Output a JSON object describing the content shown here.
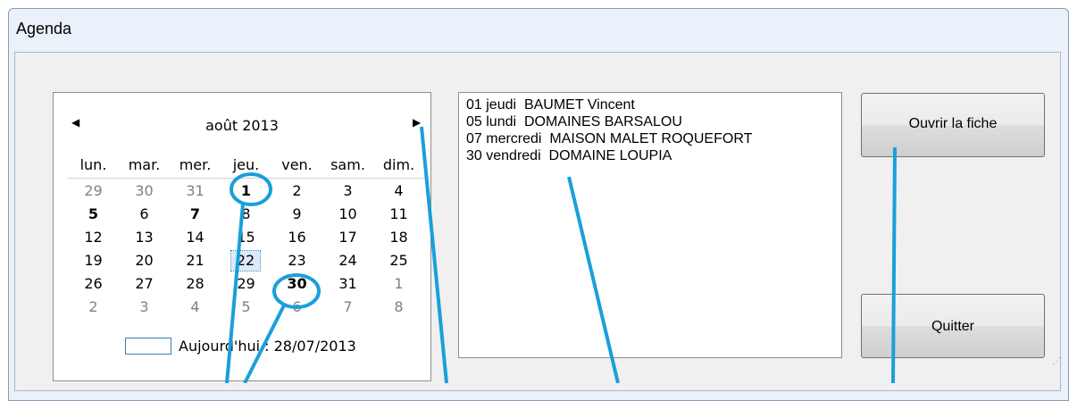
{
  "window": {
    "title": "Agenda"
  },
  "calendar": {
    "month_label": "août 2013",
    "prev_arrow": "◀",
    "next_arrow": "▶",
    "weekdays": [
      "lun.",
      "mar.",
      "mer.",
      "jeu.",
      "ven.",
      "sam.",
      "dim."
    ],
    "weeks": [
      [
        "29",
        "30",
        "31",
        "1",
        "2",
        "3",
        "4"
      ],
      [
        "5",
        "6",
        "7",
        "8",
        "9",
        "10",
        "11"
      ],
      [
        "12",
        "13",
        "14",
        "15",
        "16",
        "17",
        "18"
      ],
      [
        "19",
        "20",
        "21",
        "22",
        "23",
        "24",
        "25"
      ],
      [
        "26",
        "27",
        "28",
        "29",
        "30",
        "31",
        "1"
      ],
      [
        "2",
        "3",
        "4",
        "5",
        "6",
        "7",
        "8"
      ]
    ],
    "today_label": "Aujourd'hui : 28/07/2013"
  },
  "appointments": [
    "01 jeudi  BAUMET Vincent",
    "05 lundi  DOMAINES BARSALOU",
    "07 mercredi  MAISON MALET ROQUEFORT",
    "30 vendredi  DOMAINE LOUPIA"
  ],
  "buttons": {
    "open": "Ouvrir la fiche",
    "quit": "Quitter"
  },
  "colors": {
    "annotation": "#1a9fdb",
    "window_frame": "#eaf1fa",
    "client_bg": "#f0f0f0",
    "other_month_day": "#808080"
  }
}
